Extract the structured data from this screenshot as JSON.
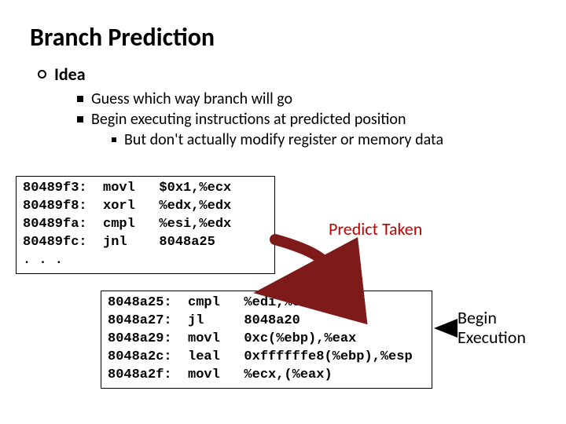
{
  "title": "Branch Prediction",
  "idea_label": "Idea",
  "bullets": {
    "b1": "Guess which way branch will go",
    "b2": "Begin executing instructions at predicted position",
    "b3": "But don't actually modify register or memory data"
  },
  "code1": "80489f3:  movl   $0x1,%ecx\n80489f8:  xorl   %edx,%edx\n80489fa:  cmpl   %esi,%edx\n80489fc:  jnl    8048a25\n. . .",
  "code2": "8048a25:  cmpl   %edi,%edx\n8048a27:  jl     8048a20\n8048a29:  movl   0xc(%ebp),%eax\n8048a2c:  leal   0xffffffe8(%ebp),%esp\n8048a2f:  movl   %ecx,(%eax)",
  "predict_label": "Predict Taken",
  "begin_label_l1": "Begin",
  "begin_label_l2": "Execution"
}
